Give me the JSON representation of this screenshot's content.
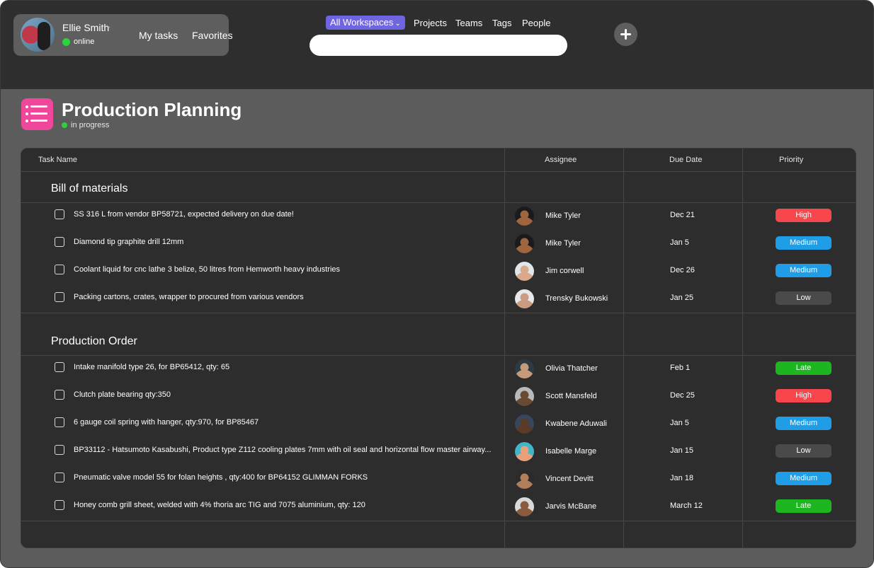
{
  "user": {
    "name": "Ellie Smith",
    "status": "online"
  },
  "nav": {
    "my_tasks": "My tasks",
    "favorites": "Favorites"
  },
  "topnav": {
    "workspace": "All Workspaces",
    "items": [
      "Projects",
      "Teams",
      "Tags",
      "People"
    ]
  },
  "search": {
    "placeholder": ""
  },
  "icons": {
    "user_chevron": "chevron-down-icon",
    "workspace_chevron": "chevron-down-icon",
    "add": "plus-icon",
    "project": "list-icon"
  },
  "colors": {
    "accent": "#6f65e0",
    "project_icon": "#f0479b",
    "online": "#2bd43a",
    "high": "#f7464c",
    "medium": "#1f9de7",
    "low": "#4a4a4a",
    "late": "#1db520"
  },
  "project": {
    "title": "Production Planning",
    "status": "in progress"
  },
  "table": {
    "headers": {
      "task": "Task Name",
      "assignee": "Assignee",
      "due": "Due Date",
      "priority": "Priority"
    },
    "sections": [
      {
        "title": "Bill of materials",
        "rows": [
          {
            "task": "SS 316 L from vendor BP58721, expected delivery on due date!",
            "assignee": "Mike Tyler",
            "due": "Dec 21",
            "priority": "High",
            "level": "high"
          },
          {
            "task": "Diamond tip graphite drill 12mm",
            "assignee": "Mike Tyler",
            "due": "Jan 5",
            "priority": "Medium",
            "level": "medium"
          },
          {
            "task": "Coolant liquid for cnc lathe 3 belize, 50 litres from Hemworth heavy industries",
            "assignee": "Jim corwell",
            "due": "Dec 26",
            "priority": "Medium",
            "level": "medium"
          },
          {
            "task": "Packing cartons, crates, wrapper to procured from various vendors",
            "assignee": "Trensky Bukowski",
            "due": "Jan 25",
            "priority": "Low",
            "level": "low"
          }
        ]
      },
      {
        "title": "Production Order",
        "rows": [
          {
            "task": "Intake manifold type 26, for BP65412, qty: 65",
            "assignee": "Olivia Thatcher",
            "due": "Feb 1",
            "priority": "Late",
            "level": "late"
          },
          {
            "task": "Clutch plate bearing qty:350",
            "assignee": "Scott Mansfeld",
            "due": "Dec 25",
            "priority": "High",
            "level": "high"
          },
          {
            "task": "6 gauge coil spring with hanger, qty:970, for BP85467",
            "assignee": "Kwabene Aduwali",
            "due": "Jan 5",
            "priority": "Medium",
            "level": "medium"
          },
          {
            "task": "BP33112 - Hatsumoto Kasabushi, Product type Z112 cooling plates 7mm with oil seal and horizontal flow master airway...",
            "assignee": "Isabelle Marge",
            "due": "Jan 15",
            "priority": "Low",
            "level": "low"
          },
          {
            "task": "Pneumatic valve model 55 for folan heights , qty:400 for BP64152 GLIMMAN FORKS",
            "assignee": "Vincent Devitt",
            "due": "Jan 18",
            "priority": "Medium",
            "level": "medium"
          },
          {
            "task": "Honey comb grill sheet, welded with 4% thoria arc TIG and 7075 aluminium, qty: 120",
            "assignee": "Jarvis McBane",
            "due": "March 12",
            "priority": "Late",
            "level": "late"
          }
        ]
      }
    ]
  }
}
